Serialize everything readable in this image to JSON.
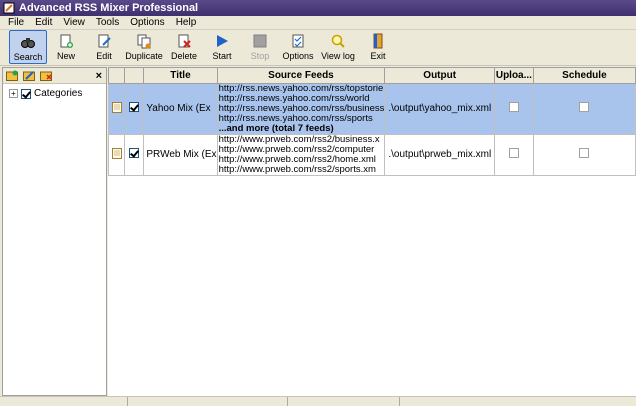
{
  "window": {
    "title": "Advanced RSS Mixer Professional"
  },
  "menu": [
    "File",
    "Edit",
    "View",
    "Tools",
    "Options",
    "Help"
  ],
  "toolbar": [
    {
      "label": "Search",
      "icon": "binoculars-icon"
    },
    {
      "label": "New",
      "icon": "new-document-icon"
    },
    {
      "label": "Edit",
      "icon": "edit-document-icon"
    },
    {
      "label": "Duplicate",
      "icon": "duplicate-icon"
    },
    {
      "label": "Delete",
      "icon": "delete-icon"
    },
    {
      "label": "Start",
      "icon": "play-icon"
    },
    {
      "label": "Stop",
      "icon": "stop-icon"
    },
    {
      "label": "Options",
      "icon": "checklist-icon"
    },
    {
      "label": "View log",
      "icon": "magnifier-icon"
    },
    {
      "label": "Exit",
      "icon": "exit-door-icon"
    }
  ],
  "tree": {
    "root": "Categories",
    "checked": true
  },
  "table": {
    "columns": [
      "",
      "",
      "Title",
      "Source Feeds",
      "Output",
      "Uploa...",
      "Schedule"
    ],
    "rows": [
      {
        "checked": true,
        "title": "Yahoo Mix (Ex",
        "feeds": [
          "http://rss.news.yahoo.com/rss/topstorie",
          "http://rss.news.yahoo.com/rss/world",
          "http://rss.news.yahoo.com/rss/business",
          "http://rss.news.yahoo.com/rss/sports"
        ],
        "more": "...and more (total 7 feeds)",
        "output": ".\\output\\yahoo_mix.xml",
        "upload": false,
        "schedule": false
      },
      {
        "checked": true,
        "title": "PRWeb Mix (Ex",
        "feeds": [
          "http://www.prweb.com/rss2/business.x",
          "http://www.prweb.com/rss2/computer",
          "http://www.prweb.com/rss2/home.xml",
          "http://www.prweb.com/rss2/sports.xm"
        ],
        "more": "",
        "output": ".\\output\\prweb_mix.xml",
        "upload": false,
        "schedule": false
      }
    ]
  },
  "colors": {
    "title_bar": "#3f2f6e",
    "selected_row": "#a8c4ec",
    "toolbar_active": "#c1d2ee"
  }
}
